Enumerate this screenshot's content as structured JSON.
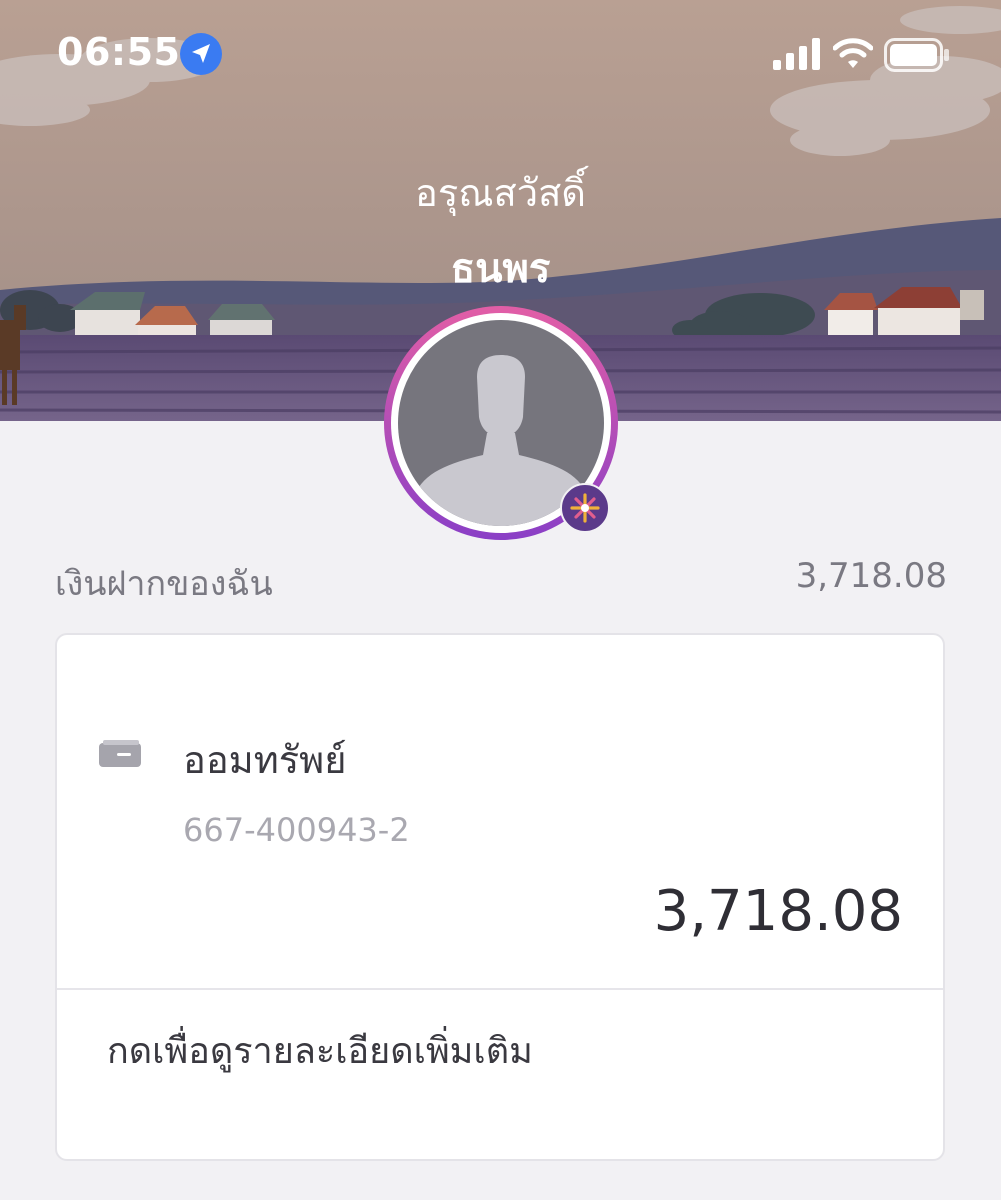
{
  "status_bar": {
    "time": "06:55",
    "location_icon": "location-arrow-icon",
    "signal_icon": "cellular-signal-icon",
    "wifi_icon": "wifi-icon",
    "battery_icon": "battery-icon"
  },
  "header": {
    "greeting": "อรุณสวัสดิ์",
    "user_name": "ธนพร",
    "avatar_icon": "user-silhouette-icon",
    "badge_icon": "sparkle-badge-icon"
  },
  "deposits": {
    "label": "เงินฝากของฉัน",
    "total": "3,718.08"
  },
  "account_card": {
    "icon": "bank-card-icon",
    "name": "ออมทรัพย์",
    "number": "667-400943-2",
    "balance": "3,718.08",
    "details_link": "กดเพื่อดูรายละเอียดเพิ่มเติม"
  },
  "colors": {
    "background": "#f2f1f4",
    "card": "#ffffff",
    "avatar_ring_top": "#e25ea6",
    "avatar_ring_bottom": "#8a3fc6",
    "location_blue": "#3a7bf2",
    "muted_text": "#7a7982"
  }
}
